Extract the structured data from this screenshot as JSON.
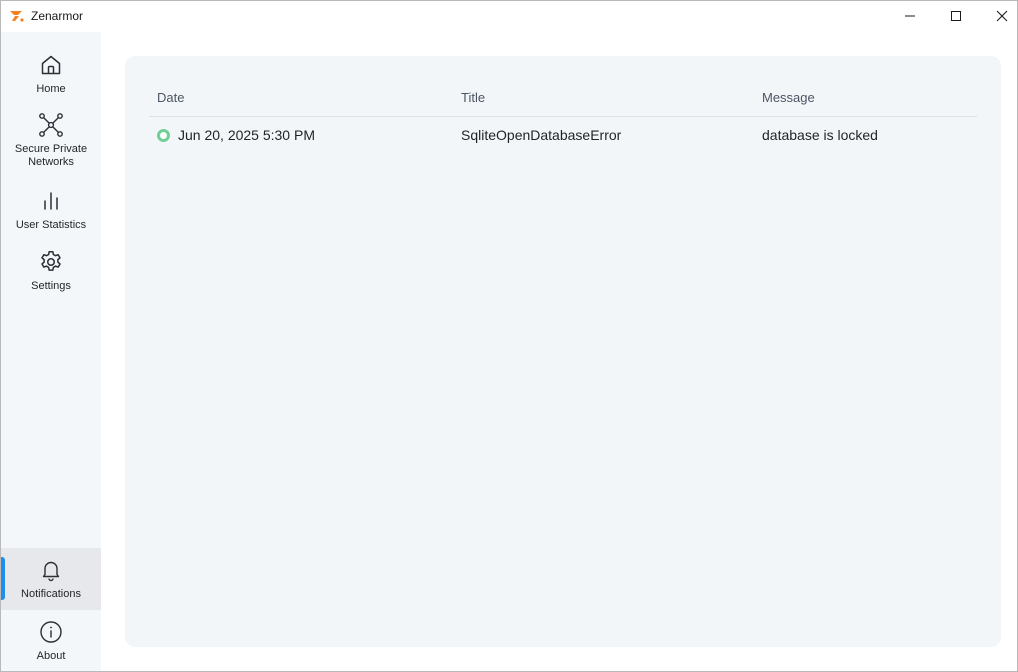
{
  "window": {
    "title": "Zenarmor",
    "accent": "#1f8ee8",
    "logo_color": "#f58220"
  },
  "sidebar": {
    "items": [
      {
        "label": "Home",
        "icon": "home-icon"
      },
      {
        "label": "Secure Private Networks",
        "icon": "network-nodes-icon"
      },
      {
        "label": "User Statistics",
        "icon": "bar-chart-icon"
      },
      {
        "label": "Settings",
        "icon": "gear-icon"
      },
      {
        "label": "Notifications",
        "icon": "bell-icon",
        "active": true
      },
      {
        "label": "About",
        "icon": "info-icon"
      }
    ]
  },
  "notifications": {
    "columns": [
      "Date",
      "Title",
      "Message"
    ],
    "rows": [
      {
        "date": "Jun 20, 2025 5:30 PM",
        "title": "SqliteOpenDatabaseError",
        "message": "database is locked",
        "status_color": "#6fcf97"
      }
    ]
  }
}
